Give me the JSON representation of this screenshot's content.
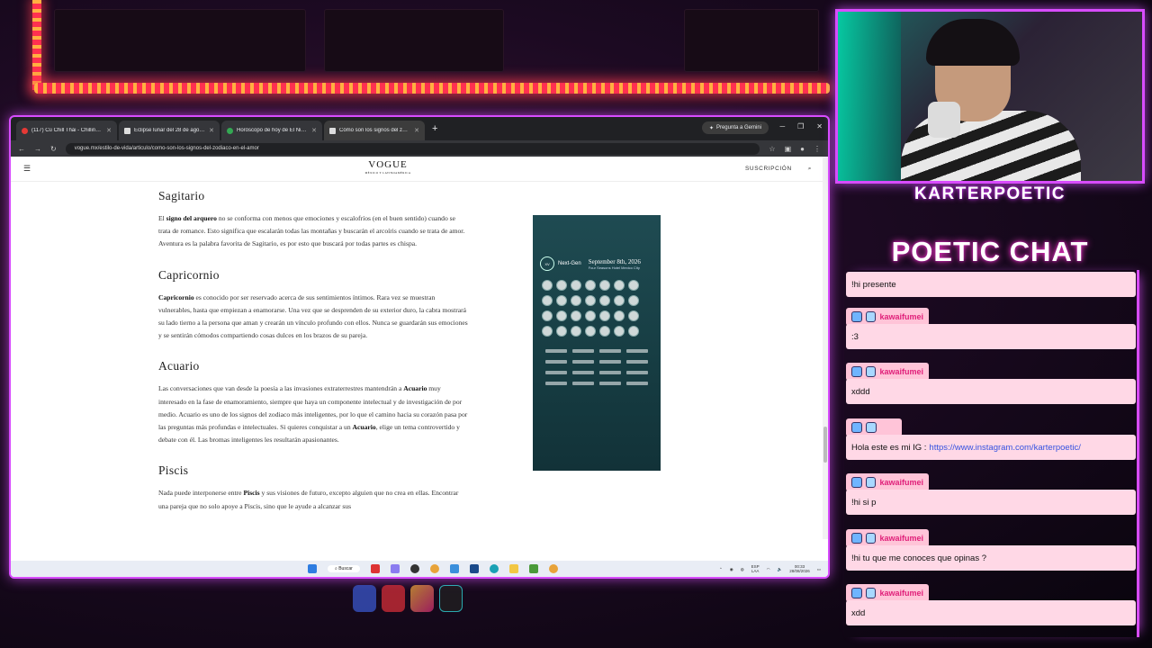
{
  "browser": {
    "tabs": [
      {
        "title": "(117) Cú Chill Thái - Chillin…",
        "favicon_color": "#e53935"
      },
      {
        "title": "Eclipse lunar del 28 de agosto…",
        "favicon_color": "#dddddd"
      },
      {
        "title": "Horóscopo de hoy de El Niño…",
        "favicon_color": "#34a853"
      },
      {
        "title": "Cómo son los signos del zodia…",
        "favicon_color": "#dddddd",
        "active": true
      }
    ],
    "gemini_label": "Pregunta a Gemini",
    "url": "vogue.mx/estilo-de-vida/articulo/como-son-los-signos-del-zodiaco-en-el-amor"
  },
  "site": {
    "logo": "VOGUE",
    "logo_sub": "MÉXICO Y LATINOAMÉRICA",
    "subscribe_label": "SUSCRIPCIÓN"
  },
  "article": {
    "sections": [
      {
        "heading": "Sagitario",
        "bold": "signo del arquero",
        "pre": "El ",
        "text": " no se conforma con menos que emociones y escalofríos (en el buen sentido) cuando se trata de romance. Esto significa que escalarán todas las montañas y buscarán el arcoíris cuando se trata de amor. Aventura es la palabra favorita de Sagitario, es por esto que buscará por todas partes es chispa."
      },
      {
        "heading": "Capricornio",
        "bold": "Capricornio",
        "pre": "",
        "text": " es conocido por ser reservado acerca de sus sentimientos íntimos. Rara vez se muestran vulnerables, hasta que empiezan a enamorarse. Una vez que se desprenden de su exterior duro, la cabra mostrará su lado tierno a la persona que aman y crearán un vínculo profundo con ellos. Nunca se guardarán sus emociones y se sentirán cómodos compartiendo cosas dulces en los brazos de su pareja."
      },
      {
        "heading": "Acuario",
        "p1": "Las conversaciones que van desde la poesía a las invasiones extraterrestres mantendrán a ",
        "b1": "Acuario",
        "p2": " muy interesado en la fase de enamoramiento, siempre que haya un componente intelectual y de investigación de por medio. Acuario es uno de los signos del zodiaco más inteligentes, por lo que el camino hacia su corazón pasa por las preguntas más profundas e intelectuales. Si quieres conquistar a un ",
        "b2": "Acuario",
        "p3": ", elige un tema controvertido y debate con él. Las bromas inteligentes les resultarán apasionantes."
      },
      {
        "heading": "Piscis",
        "pre": "Nada puede interponerse entre ",
        "bold": "Piscis",
        "text": " y sus visiones de futuro, excepto alguien que no crea en ellas. Encontrar una pareja que no solo apoye a Piscis, sino que le ayude a alcanzar sus"
      }
    ]
  },
  "ad": {
    "brand": "Next-Gen",
    "date": "September 8th, 2026",
    "venue": "Four Seasons Hotel Mexico City"
  },
  "taskbar": {
    "search_label": "Buscar",
    "lang": "ESP",
    "lang_sub": "LAA",
    "time": "00:33",
    "date": "28/08/2026"
  },
  "stream": {
    "streamer": "KARTERPOETIC",
    "chat_title": "POETIC CHAT",
    "accent": "#d84cff"
  },
  "chat": [
    {
      "user": "",
      "text": "!hi presente"
    },
    {
      "user": "kawaifumei",
      "text": ":3"
    },
    {
      "user": "kawaifumei",
      "text": "xddd"
    },
    {
      "user": "",
      "user_color": "green",
      "text": "Hola este es mi IG :",
      "link": "https://www.instagram.com/karterpoetic/"
    },
    {
      "user": "kawaifumei",
      "text": "!hi si p"
    },
    {
      "user": "kawaifumei",
      "text": "!hi tu que me conoces que opinas ?"
    },
    {
      "user": "kawaifumei",
      "text": "xdd"
    }
  ]
}
